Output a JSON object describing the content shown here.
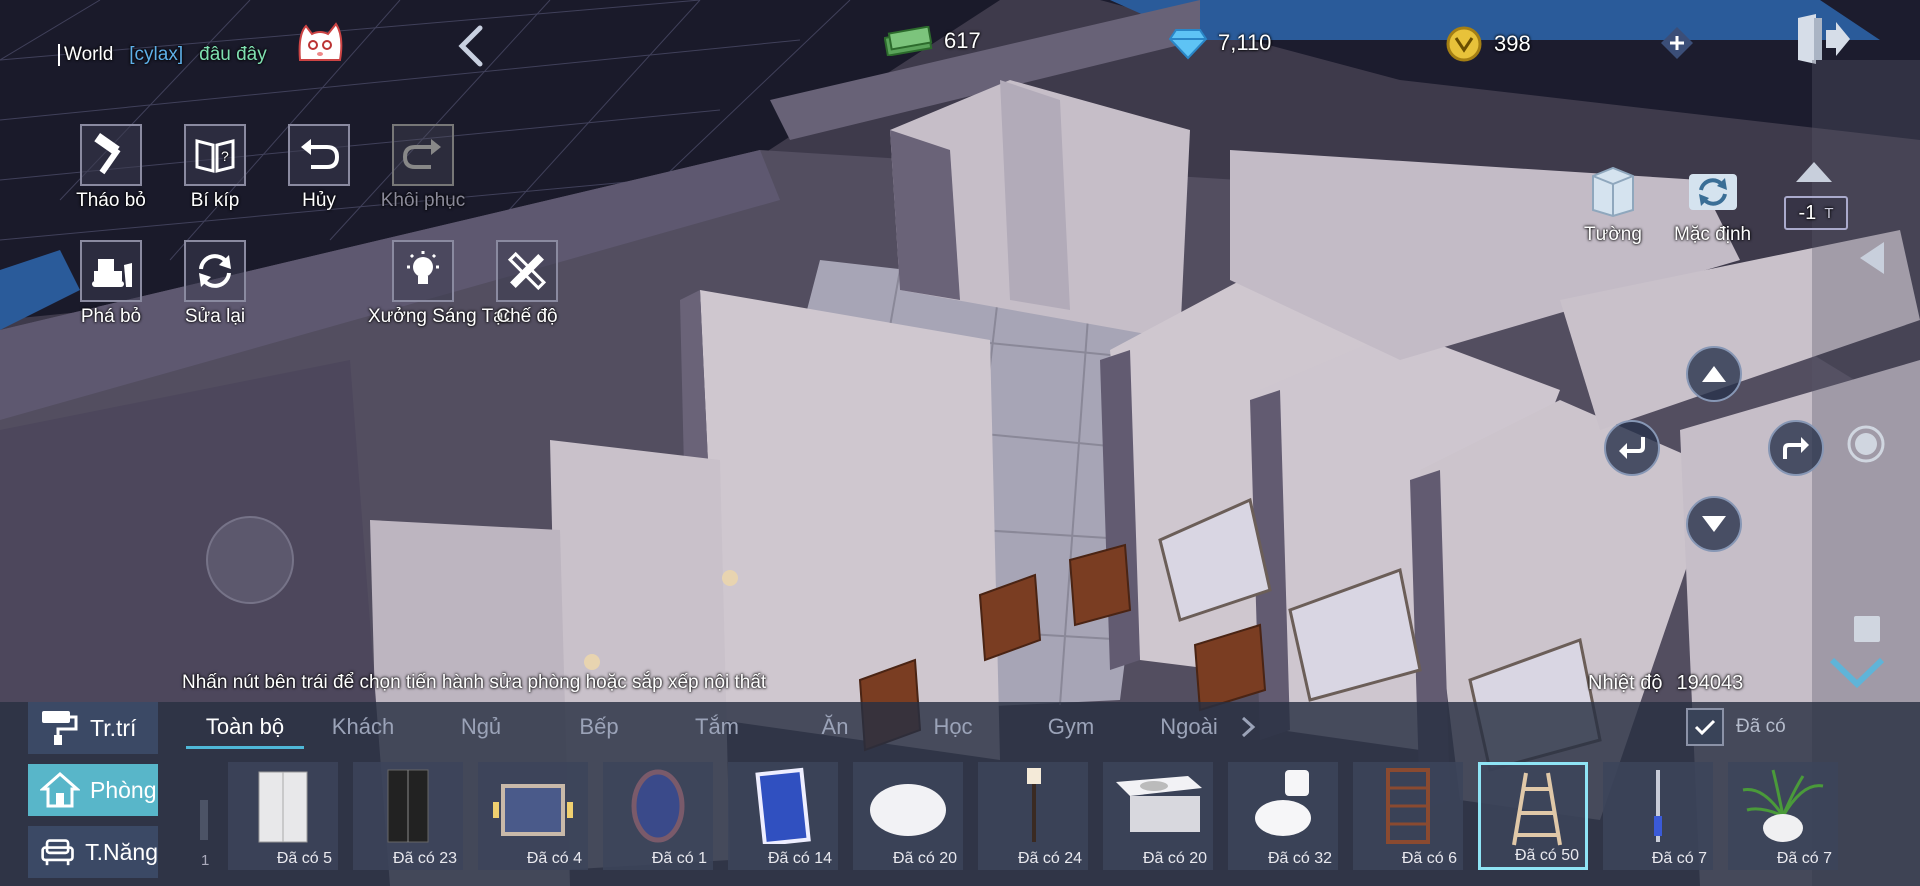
{
  "chat": {
    "channel": "World",
    "name": "[cylax]",
    "message": "đâu đây"
  },
  "currency": {
    "cash": "617",
    "diamonds": "7,110",
    "coins": "398"
  },
  "tools": [
    {
      "label": "Tháo bỏ",
      "icon": "hammer-icon",
      "enabled": true
    },
    {
      "label": "Bí kíp",
      "icon": "guide-book-icon",
      "enabled": true
    },
    {
      "label": "Hủy",
      "icon": "undo-icon",
      "enabled": true
    },
    {
      "label": "Khôi phục",
      "icon": "redo-icon",
      "enabled": false
    },
    {
      "label": "Phá bỏ",
      "icon": "bulldozer-icon",
      "enabled": true
    },
    {
      "label": "Sửa lại",
      "icon": "refresh-icon",
      "enabled": true
    },
    {
      "label": "Xưởng Sáng Tạo",
      "icon": "lightbulb-icon",
      "enabled": true
    },
    {
      "label": "Chế độ",
      "icon": "pencil-ruler-icon",
      "enabled": true
    }
  ],
  "right_tools": {
    "wall": "Tường",
    "default": "Mặc định"
  },
  "floor": {
    "value": "-1",
    "unit": "T"
  },
  "hint": "Nhấn nút bên trái để chọn tiến hành sửa phòng hoặc sắp xếp nội thất",
  "temperature": {
    "label": "Nhiệt độ",
    "value": "194043"
  },
  "sidebar": [
    {
      "label": "Tr.trí",
      "icon": "paint-roller-icon",
      "active": false
    },
    {
      "label": "Phòng",
      "icon": "house-icon",
      "active": true
    },
    {
      "label": "T.Năng",
      "icon": "sofa-icon",
      "active": false
    }
  ],
  "tabs": [
    "Toàn bộ",
    "Khách",
    "Ngủ",
    "Bếp",
    "Tắm",
    "Ăn",
    "Học",
    "Gym",
    "Ngoài"
  ],
  "owned_filter": {
    "label": "Đã có",
    "checked": true
  },
  "page_number": "1",
  "items": [
    {
      "count": "Đã có 5",
      "icon": "wardrobe-icon"
    },
    {
      "count": "Đã có 23",
      "icon": "glass-cabinet-icon"
    },
    {
      "count": "Đã có 4",
      "icon": "mirror-cabinet-icon"
    },
    {
      "count": "Đã có 1",
      "icon": "oval-mirror-icon"
    },
    {
      "count": "Đã có 14",
      "icon": "led-mirror-icon"
    },
    {
      "count": "Đã có 20",
      "icon": "round-rug-icon"
    },
    {
      "count": "Đã có 24",
      "icon": "floor-lamp-icon"
    },
    {
      "count": "Đã có 20",
      "icon": "sink-vanity-icon"
    },
    {
      "count": "Đã có 32",
      "icon": "toilet-icon"
    },
    {
      "count": "Đã có 6",
      "icon": "bookshelf-icon"
    },
    {
      "count": "Đã có 50",
      "icon": "ladder-shelf-icon",
      "selected": true
    },
    {
      "count": "Đã có 7",
      "icon": "candle-stand-icon"
    },
    {
      "count": "Đã có 7",
      "icon": "potted-plant-icon"
    }
  ]
}
